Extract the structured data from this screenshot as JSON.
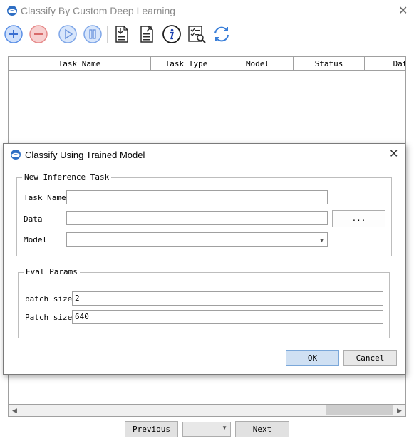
{
  "main": {
    "title": "Classify By Custom Deep Learning",
    "close_glyph": "✕",
    "toolbar": [
      {
        "name": "add-icon",
        "color": "#5a8fe6"
      },
      {
        "name": "remove-icon",
        "color": "#e68a8a"
      },
      {
        "name": "play-icon",
        "color": "#7ea6e8"
      },
      {
        "name": "pause-icon",
        "color": "#7ea6e8"
      },
      {
        "name": "import-file-icon",
        "color": "#2b2b2b"
      },
      {
        "name": "export-file-icon",
        "color": "#2b2b2b"
      },
      {
        "name": "info-icon",
        "color": "#1a3fb0"
      },
      {
        "name": "checklist-search-icon",
        "color": "#2b2b2b"
      },
      {
        "name": "refresh-icon",
        "color": "#3a7fd9"
      }
    ],
    "table": {
      "columns": [
        "Task Name",
        "Task Type",
        "Model",
        "Status",
        "Dat"
      ]
    },
    "scrollbar": {
      "left_arrow": "◀",
      "right_arrow": "▶",
      "thumb_start": 0.82,
      "thumb_end": 1.0
    },
    "pager": {
      "previous_label": "Previous",
      "next_label": "Next",
      "page_value": "",
      "dropdown_arrow": "▼"
    }
  },
  "dialog": {
    "title": "Classify Using Trained Model",
    "close_glyph": "✕",
    "inference_group": {
      "legend": "New Inference Task",
      "task_name_label": "Task Name",
      "task_name_value": "",
      "data_label": "Data",
      "data_value": "",
      "browse_label": "...",
      "model_label": "Model",
      "model_value": "",
      "dropdown_arrow": "▼"
    },
    "eval_group": {
      "legend": "Eval Params",
      "batch_size_label": "batch size",
      "batch_size_value": "2",
      "patch_size_label": "Patch size",
      "patch_size_value": "640"
    },
    "ok_label": "OK",
    "cancel_label": "Cancel"
  },
  "colors": {
    "accent": "#5a8fe6",
    "ok_button_bg": "#cfe0f3",
    "ok_button_border": "#7aa7d9"
  }
}
